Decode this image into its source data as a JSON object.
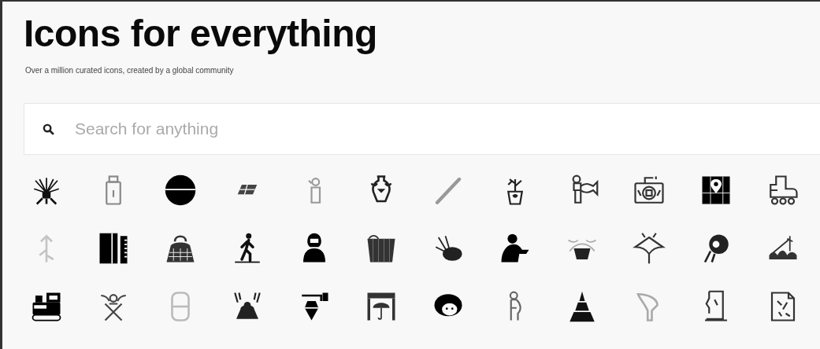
{
  "header": {
    "title": "Icons for everything",
    "subtitle": "Over a million curated icons, created by a global community"
  },
  "search": {
    "placeholder": "Search for anything"
  }
}
